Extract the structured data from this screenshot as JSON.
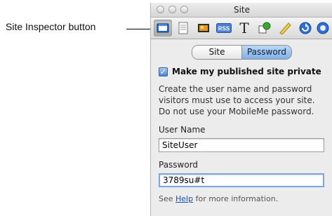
{
  "callout": {
    "label": "Site Inspector button"
  },
  "window": {
    "title": "Site"
  },
  "toolbar": {
    "buttons": [
      {
        "icon": "site-inspector-icon",
        "active": true
      },
      {
        "icon": "page-icon"
      },
      {
        "icon": "photo-icon"
      },
      {
        "icon": "rss-icon",
        "label": "RSS"
      },
      {
        "icon": "text-icon",
        "label": "T"
      },
      {
        "icon": "graphic-icon"
      },
      {
        "icon": "metrics-icon"
      },
      {
        "icon": "link-icon"
      },
      {
        "icon": "qt-icon"
      }
    ]
  },
  "tabs": {
    "site": "Site",
    "password": "Password"
  },
  "form": {
    "private_label": "Make my published site private",
    "private_checked": true,
    "description": "Create the user name and password visitors must use to access your site. Do not use your MobileMe password.",
    "username_label": "User Name",
    "username_value": "SiteUser",
    "password_label": "Password",
    "password_value": "3789su#t",
    "help_prefix": "See ",
    "help_link": "Help",
    "help_suffix": " for more information."
  }
}
